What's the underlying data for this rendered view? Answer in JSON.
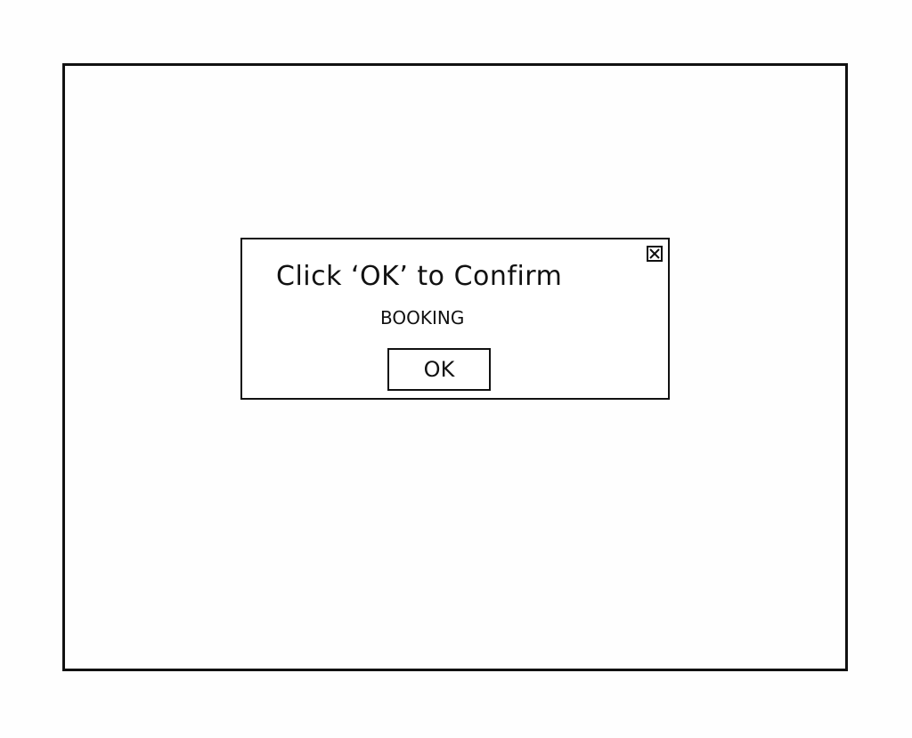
{
  "dialog": {
    "message_line1": "Click ‘OK’ to Confirm",
    "message_line2": "Booking",
    "ok_label": "OK",
    "close_icon": "close-box-icon"
  }
}
